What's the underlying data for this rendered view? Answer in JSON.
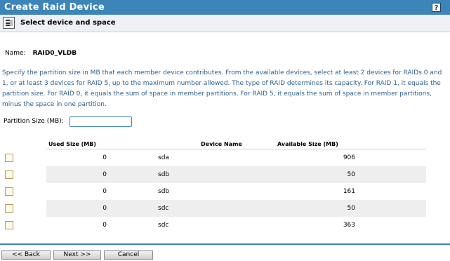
{
  "window": {
    "title": "Create Raid Device",
    "help_label": "?"
  },
  "subheader": {
    "icon": "form-icon",
    "title": "Select device and space"
  },
  "name": {
    "label": "Name:",
    "value": "RAID0_VLDB"
  },
  "description": "Specify the partition size in MB that each member device contributes. From the available devices, select at least 2 devices for RAIDs 0 and 1, or at least 3 devices for RAID 5, up to the maximum number allowed. The type of RAID determines its capacity. For RAID 1, it equals the partition size. For RAID 0, it equals the sum of space in member partitions. For RAID 5, it equals the sum of space in member partitions, minus the space in one partition.",
  "partition": {
    "label": "Partition Size (MB):",
    "value": ""
  },
  "table": {
    "columns": [
      "Used Size (MB)",
      "Device Name",
      "Available Size (MB)"
    ],
    "rows": [
      {
        "used": "0",
        "device": "sda",
        "available": "906"
      },
      {
        "used": "0",
        "device": "sdb",
        "available": "50"
      },
      {
        "used": "0",
        "device": "sdb",
        "available": "161"
      },
      {
        "used": "0",
        "device": "sdc",
        "available": "50"
      },
      {
        "used": "0",
        "device": "sdc",
        "available": "363"
      }
    ]
  },
  "buttons": {
    "back": "<< Back",
    "next": "Next >>",
    "cancel": "Cancel"
  },
  "colors": {
    "title_bar": "#3d84b8",
    "description_text": "#2b5f8e"
  }
}
